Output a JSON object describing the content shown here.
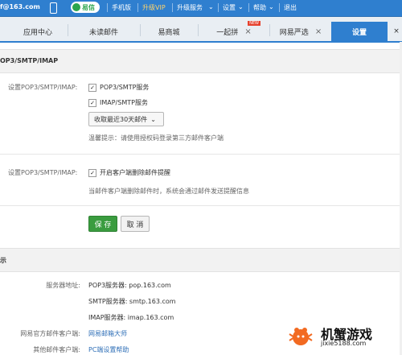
{
  "topbar": {
    "account": "f@163.com",
    "yixin_label": "易信",
    "items": [
      "手机版",
      "升级VIP",
      "升级服务",
      "设置",
      "帮助",
      "退出"
    ]
  },
  "tabs": [
    {
      "label": "应用中心"
    },
    {
      "label": "未读邮件"
    },
    {
      "label": "易商城"
    },
    {
      "label": "一起拼",
      "badge": "NEW"
    },
    {
      "label": "网易严选"
    },
    {
      "label": "设置",
      "active": true
    }
  ],
  "section1": {
    "title": "OP3/SMTP/IMAP",
    "label1": "设置POP3/SMTP/IMAP:",
    "option1": "POP3/SMTP服务",
    "option2": "IMAP/SMTP服务",
    "select_value": "收取最近30天邮件",
    "hint": "温馨提示：请使用授权码登录第三方邮件客户端",
    "label2": "设置POP3/SMTP/IMAP:",
    "option3": "开启客户端删除邮件提醒",
    "hint2": "当邮件客户端删除邮件时，系统会通过邮件发送提醒信息",
    "save": "保 存",
    "cancel": "取 消"
  },
  "section2": {
    "title": "示",
    "server_label": "服务器地址:",
    "pop3": "POP3服务器: pop.163.com",
    "smtp": "SMTP服务器: smtp.163.com",
    "imap": "IMAP服务器: imap.163.com",
    "official_label": "网易官方邮件客户端:",
    "official_value": "网易邮箱大师",
    "other_label": "其他邮件客户端:",
    "other_value": "PC端设置帮助"
  },
  "watermark": {
    "title": "机蟹游戏",
    "url": "jixie5188.com"
  },
  "colors": {
    "topbar": "#2f7fcf",
    "active_tab": "#2f7fcf",
    "save_button": "#3a9c3f",
    "link": "#2f6fb7"
  }
}
